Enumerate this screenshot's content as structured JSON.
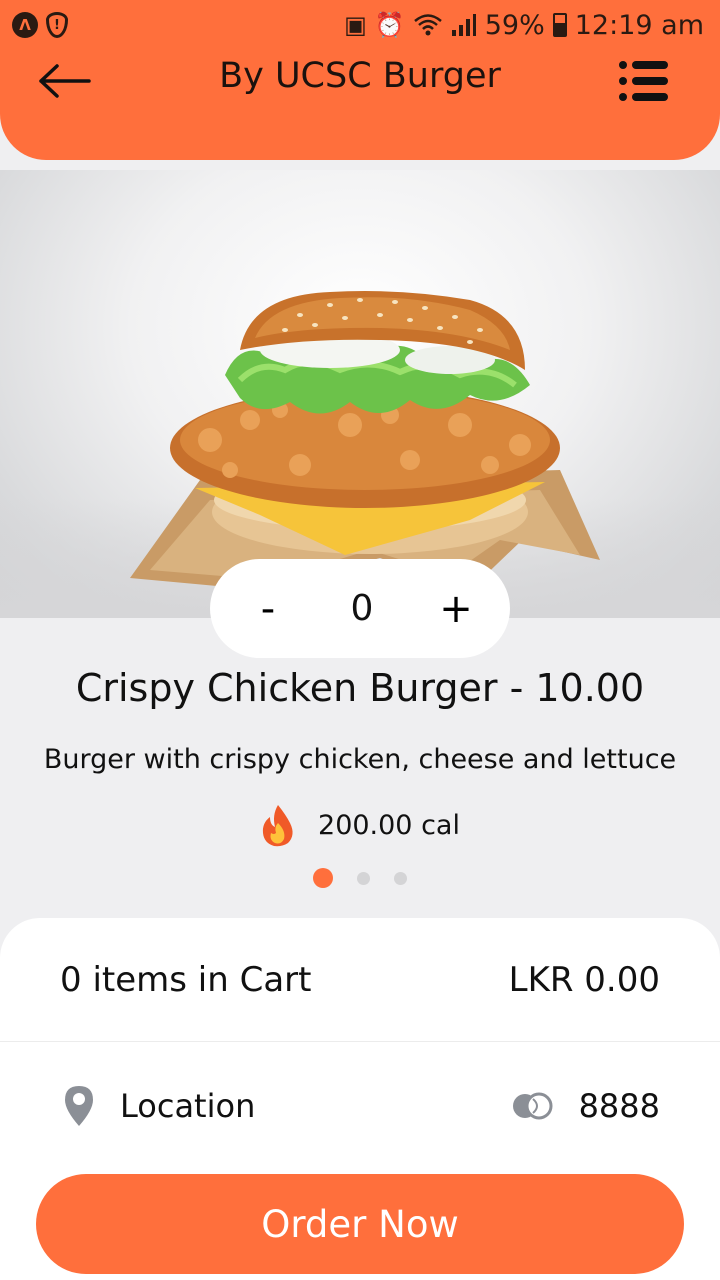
{
  "status_bar": {
    "battery": "59%",
    "time": "12:19 am"
  },
  "header": {
    "title": "By UCSC Burger",
    "back_icon": "arrow-left-icon",
    "menu_icon": "list-menu-icon"
  },
  "product": {
    "quantity": "0",
    "decrement_label": "-",
    "increment_label": "+",
    "title": "Crispy Chicken Burger - 10.00",
    "description": "Burger with crispy chicken, cheese and lettuce",
    "calories": "200.00 cal",
    "carousel_pages": 3,
    "carousel_active": 0
  },
  "cart": {
    "items_text": "0 items in Cart",
    "total": "LKR 0.00"
  },
  "info": {
    "location_label": "Location",
    "points": "8888"
  },
  "order_button": "Order Now",
  "colors": {
    "accent": "#ff6f3c",
    "background": "#efeff1",
    "card": "#ffffff"
  }
}
